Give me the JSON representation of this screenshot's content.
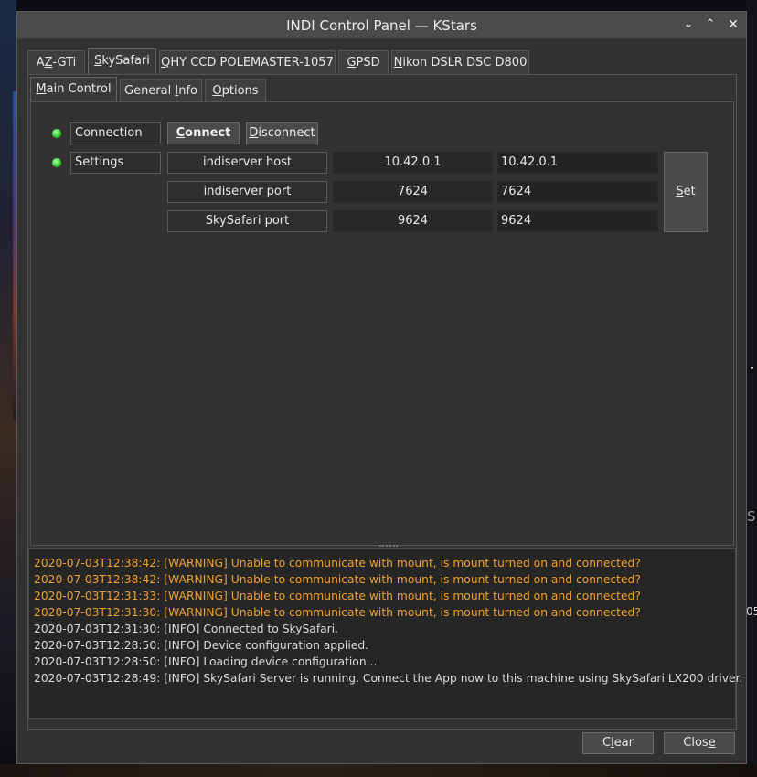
{
  "window": {
    "title": "INDI Control Panel — KStars"
  },
  "device_tabs": [
    {
      "pre": "A",
      "key": "Z",
      "post": "-GTi"
    },
    {
      "pre": "",
      "key": "S",
      "post": "kySafari"
    },
    {
      "pre": "",
      "key": "Q",
      "post": "HY CCD POLEMASTER-1057"
    },
    {
      "pre": "",
      "key": "G",
      "post": "PSD"
    },
    {
      "pre": "",
      "key": "N",
      "post": "ikon DSLR DSC D800"
    }
  ],
  "group_tabs": [
    {
      "pre": "",
      "key": "M",
      "post": "ain Control"
    },
    {
      "pre": "General ",
      "key": "I",
      "post": "nfo"
    },
    {
      "pre": "",
      "key": "O",
      "post": "ptions"
    }
  ],
  "connection": {
    "label": "Connection",
    "connect": {
      "pre": "",
      "key": "C",
      "post": "onnect"
    },
    "disconnect": {
      "pre": "",
      "key": "D",
      "post": "isconnect"
    },
    "status_color": "#2ec92e"
  },
  "settings": {
    "label": "Settings",
    "status_color": "#2ec92e",
    "rows": [
      {
        "name": "indiserver host",
        "current": "10.42.0.1",
        "input": "10.42.0.1"
      },
      {
        "name": "indiserver port",
        "current": "7624",
        "input": "7624"
      },
      {
        "name": "SkySafari port",
        "current": "9624",
        "input": "9624"
      }
    ],
    "set": {
      "pre": "",
      "key": "S",
      "post": "et"
    }
  },
  "log": [
    {
      "level": "warn",
      "text": "2020-07-03T12:38:42: [WARNING] Unable to communicate with mount, is mount turned on and connected?"
    },
    {
      "level": "warn",
      "text": "2020-07-03T12:38:42: [WARNING] Unable to communicate with mount, is mount turned on and connected?"
    },
    {
      "level": "warn",
      "text": "2020-07-03T12:31:33: [WARNING] Unable to communicate with mount, is mount turned on and connected?"
    },
    {
      "level": "warn",
      "text": "2020-07-03T12:31:30: [WARNING] Unable to communicate with mount, is mount turned on and connected?"
    },
    {
      "level": "info",
      "text": "2020-07-03T12:31:30: [INFO] Connected to SkySafari."
    },
    {
      "level": "info",
      "text": "2020-07-03T12:28:50: [INFO] Device configuration applied."
    },
    {
      "level": "info",
      "text": "2020-07-03T12:28:50: [INFO] Loading device configuration..."
    },
    {
      "level": "info",
      "text": "2020-07-03T12:28:49: [INFO] SkySafari Server is running. Connect the App now to this machine using SkySafari LX200 driver."
    }
  ],
  "footer": {
    "clear": {
      "pre": "C",
      "key": "l",
      "post": "ear"
    },
    "close": {
      "pre": "Clos",
      "key": "e",
      "post": ""
    }
  },
  "colors": {
    "warning": "#f0a030",
    "info": "#dcdcdc",
    "led_ok": "#2ec92e"
  },
  "background": {
    "right_edge_text_1": "S",
    "right_edge_text_2": "05"
  }
}
